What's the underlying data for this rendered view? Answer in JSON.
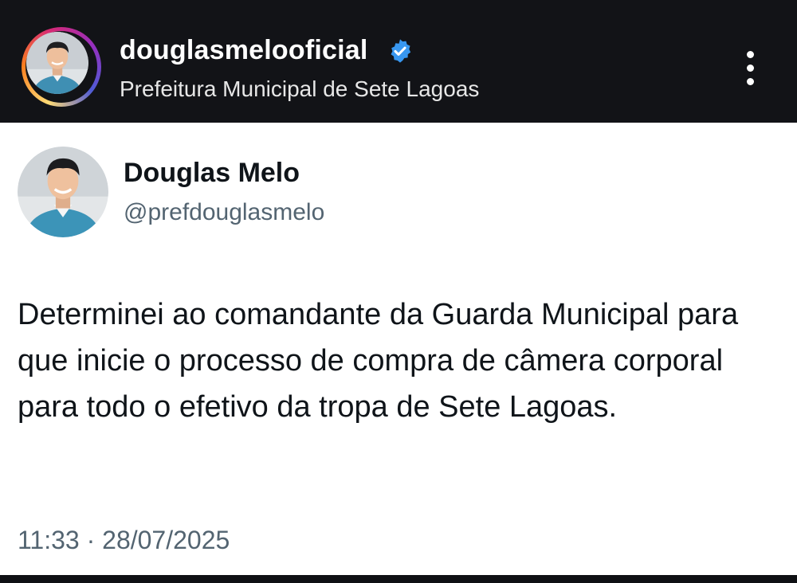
{
  "header": {
    "username": "douglasmelooficial",
    "subtitle": "Prefeitura Municipal de Sete Lagoas",
    "verified_icon": "verified-badge-icon",
    "menu_icon": "more-vertical-icon"
  },
  "tweet": {
    "name": "Douglas Melo",
    "handle": "@prefdouglasmelo",
    "text": "Determinei ao comandante da Guarda Municipal para que inicie o processo de compra de câmera corporal para todo o efetivo da tropa de Sete Lagoas.",
    "timestamp": "11:33 · 28/07/2025"
  },
  "colors": {
    "header_bg": "#121317",
    "verified": "#3897f0",
    "text_primary": "#0f1419",
    "text_secondary": "#536471"
  }
}
